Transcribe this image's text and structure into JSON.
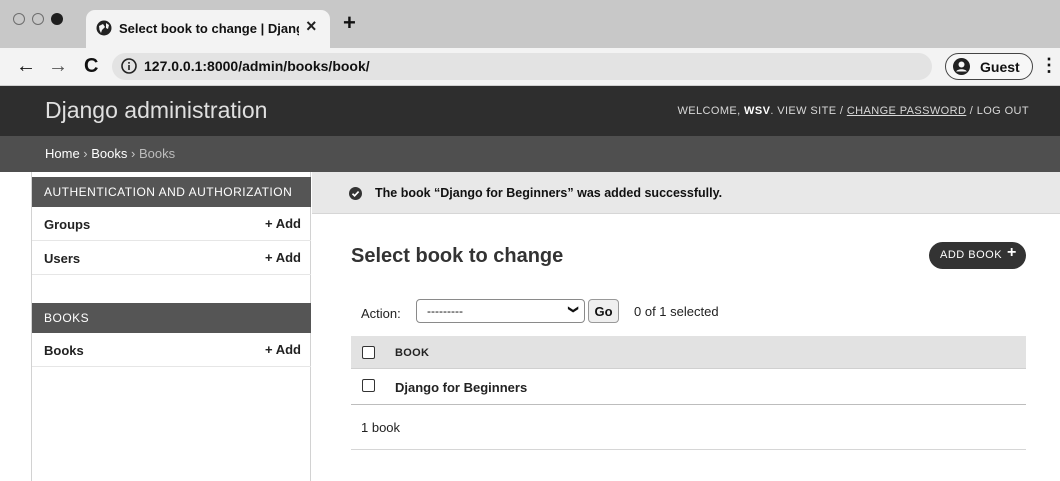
{
  "browser": {
    "tab_title": "Select book to change | Django site admin",
    "tab_close": "×",
    "new_tab": "+",
    "url": "127.0.0.1:8000/admin/books/book/",
    "profile_label": "Guest",
    "nav": {
      "back": "←",
      "forward": "→",
      "reload": "C",
      "menu": "⋮"
    }
  },
  "header": {
    "branding": "Django administration",
    "welcome": "WELCOME, ",
    "username": "WSV",
    "sep1": ". ",
    "view_site": "VIEW SITE",
    "slash1": " / ",
    "change_password": "CHANGE PASSWORD",
    "slash2": " / ",
    "log_out": "LOG OUT"
  },
  "breadcrumbs": {
    "home": "Home",
    "sep": " › ",
    "app": "Books",
    "current": "Books"
  },
  "sidebar": {
    "modules": [
      {
        "caption": "AUTHENTICATION AND AUTHORIZATION",
        "rows": [
          {
            "name": "Groups",
            "add": "+ Add"
          },
          {
            "name": "Users",
            "add": "+ Add"
          }
        ]
      },
      {
        "caption": "BOOKS",
        "rows": [
          {
            "name": "Books",
            "add": "+ Add"
          }
        ]
      }
    ]
  },
  "message": {
    "prefix": "The book “",
    "object": "Django for Beginners",
    "suffix": "” was added successfully."
  },
  "content": {
    "title": "Select book to change",
    "add_button": "ADD BOOK",
    "add_button_icon": "+"
  },
  "actions": {
    "label": "Action:",
    "selected_value": "---------",
    "go": "Go",
    "selection_count": "0 of 1 selected"
  },
  "results": {
    "column_header": "BOOK",
    "rows": [
      "Django for Beginners"
    ],
    "paginator": "1 book"
  },
  "colors": {
    "header_bg": "#2e2e2e",
    "breadcrumbs_bg": "#4f4f4f",
    "module_caption_bg": "#555555",
    "message_bg": "#e8e8e8"
  }
}
